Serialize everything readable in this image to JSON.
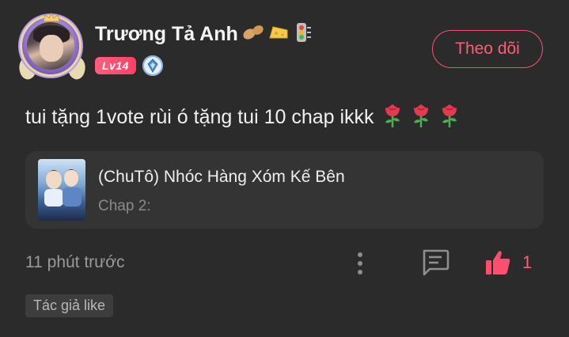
{
  "user": {
    "name": "Trương Tả Anh",
    "decorations": [
      "peanut-icon",
      "cheese-icon",
      "traffic-light-icon"
    ],
    "level": "Lv14"
  },
  "follow_label": "Theo dõi",
  "comment": {
    "text": "tui tặng 1vote rùi ó tặng tui 10 chap ikkk",
    "emoji_count": 3
  },
  "chapter": {
    "title": "(ChuTô) Nhóc Hàng Xóm Kế Bên",
    "subtitle": "Chap 2:"
  },
  "footer": {
    "time": "11 phút trước",
    "like_count": "1"
  },
  "author_tag": "Tác giả like",
  "colors": {
    "background": "#2b2b2b",
    "accent": "#ff5c78",
    "card": "#343434"
  }
}
